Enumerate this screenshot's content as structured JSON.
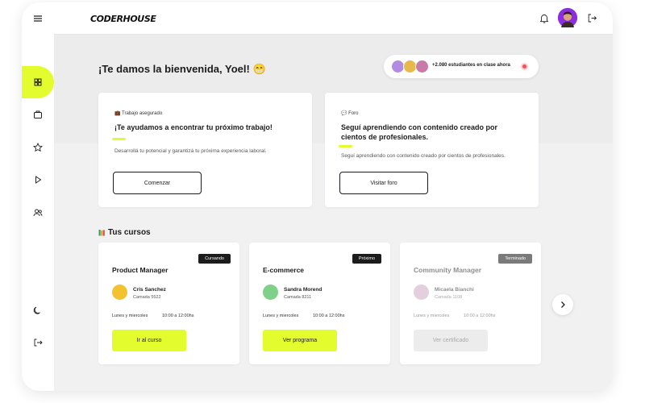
{
  "app": {
    "logo": "CODERHOUSE"
  },
  "sidebar": {
    "icons": [
      "menu-icon",
      "grid-icon",
      "briefcase-icon",
      "star-icon",
      "play-icon",
      "users-icon",
      "moon-icon",
      "logout-icon"
    ],
    "active": "grid-icon"
  },
  "header": {
    "welcome": "¡Te damos la bienvenida, Yoel! 😁",
    "students_online": "+2.080 estudiantes en clase ahora"
  },
  "promos": [
    {
      "tag": "💼 Trabajo asegurado",
      "title": "¡Te ayudamos a encontrar tu próximo trabajo!",
      "description": "Desarrollá tu potencial y garantizá tu próxima experiencia laboral.",
      "button": "Comenzar"
    },
    {
      "tag": "💬 Foro",
      "title": "Seguí aprendiendo con contenido creado por cientos de profesionales.",
      "description": "Seguí aprendiendo con contenido creado por cientos de profesionales.",
      "button": "Visitar foro"
    }
  ],
  "courses_section": {
    "title": "Tus cursos"
  },
  "courses": [
    {
      "status": "Cursando",
      "title": "Product Manager",
      "teacher": "Cris Sanchez",
      "group": "Camada 5522",
      "days": "Lunes y miercoles",
      "hours": "10:00 a 12:00hs",
      "button": "Ir al curso"
    },
    {
      "status": "Próximo",
      "title": "E-commerce",
      "teacher": "Sandra Morend",
      "group": "Camada 8211",
      "days": "Lunes y miercoles",
      "hours": "10:00 a 12:00hs",
      "button": "Ver programa"
    },
    {
      "status": "Terminado",
      "title": "Community Manager",
      "teacher": "Micaela Bianchi",
      "group": "Camada 1108",
      "days": "Lunes y miercoles",
      "hours": "10:00 a 12:00hs",
      "button": "Ver certificado"
    }
  ],
  "colors": {
    "accent": "#e3fc2e",
    "avatar": "#8c2de0",
    "live": "#f05454"
  }
}
